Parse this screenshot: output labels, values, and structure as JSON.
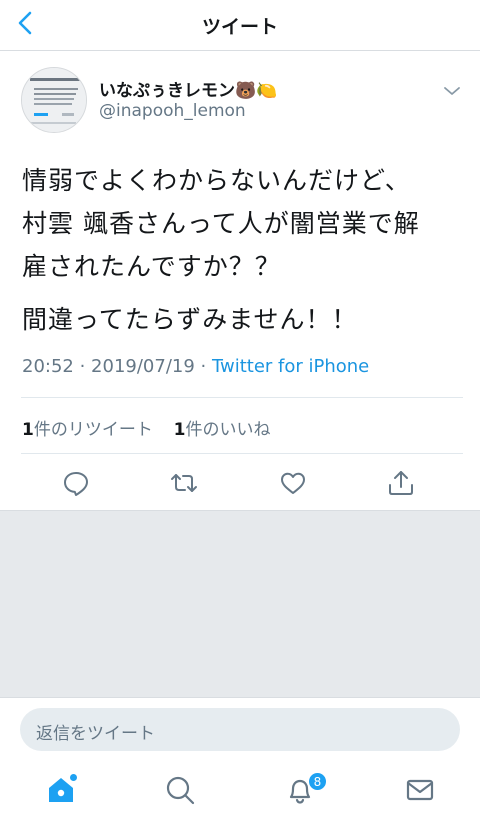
{
  "header": {
    "title": "ツイート"
  },
  "tweet": {
    "display_name": "いなぷぅきレモン🐻🍋",
    "handle": "@inapooh_lemon",
    "text_lines": [
      "情弱でよくわからないんだけど、",
      "村雲 颯香さんって人が闇営業で解",
      "雇されたんですか？？"
    ],
    "text_line2": "間違ってたらずみません！！",
    "time": "20:52",
    "date": "2019/07/19",
    "separator": " · ",
    "source": "Twitter for iPhone",
    "retweet_count": "1",
    "retweet_label": "件のリツイート",
    "like_count": "1",
    "like_label": "件のいいね"
  },
  "reply": {
    "placeholder": "返信をツイート"
  },
  "tabbar": {
    "notifications_badge": "8"
  },
  "colors": {
    "accent": "#1da1f2",
    "link": "#1b95e0",
    "secondary_text": "#657786"
  }
}
